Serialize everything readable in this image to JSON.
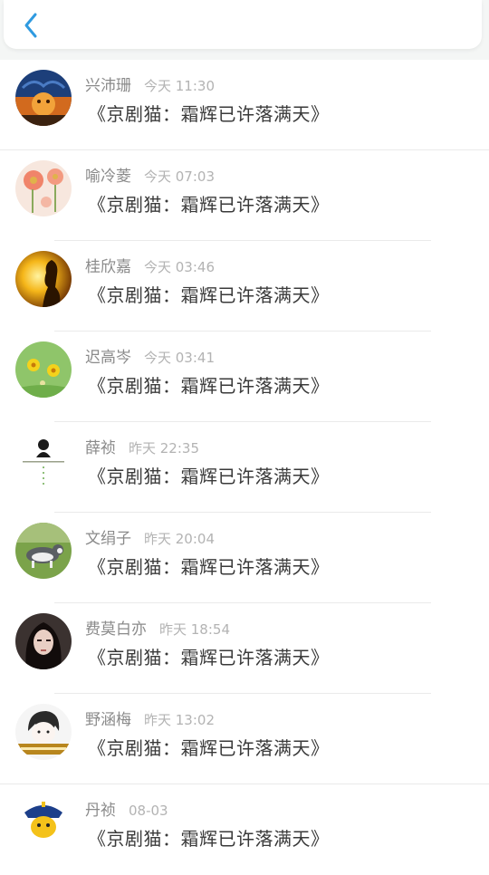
{
  "header": {
    "back_icon": "chevron-left-icon",
    "accent_color": "#2f9ae0"
  },
  "messages": [
    {
      "name": "兴沛珊",
      "time": "今天 11:30",
      "text": "《京剧猫：霜辉已许落满天》",
      "avatar": "orange-night-scene"
    },
    {
      "name": "喻冷菱",
      "time": "今天 07:03",
      "text": "《京剧猫：霜辉已许落满天》",
      "avatar": "pink-flowers"
    },
    {
      "name": "桂欣嘉",
      "time": "今天 03:46",
      "text": "《京剧猫：霜辉已许落满天》",
      "avatar": "sunset-silhouette"
    },
    {
      "name": "迟高岑",
      "time": "今天 03:41",
      "text": "《京剧猫：霜辉已许落满天》",
      "avatar": "yellow-flowers-green"
    },
    {
      "name": "薛祯",
      "time": "昨天 22:35",
      "text": "《京剧猫：霜辉已许落满天》",
      "avatar": "girl-figure-white"
    },
    {
      "name": "文绢子",
      "time": "昨天 20:04",
      "text": "《京剧猫：霜辉已许落满天》",
      "avatar": "husky-on-grass"
    },
    {
      "name": "费莫白亦",
      "time": "昨天 18:54",
      "text": "《京剧猫：霜辉已许落满天》",
      "avatar": "girl-portrait-dark"
    },
    {
      "name": "野涵梅",
      "time": "昨天 13:02",
      "text": "《京剧猫：霜辉已许落满天》",
      "avatar": "anime-boy-sketch"
    },
    {
      "name": "丹祯",
      "time": "08-03",
      "text": "《京剧猫：霜辉已许落满天》",
      "avatar": "cartoon-character"
    }
  ]
}
